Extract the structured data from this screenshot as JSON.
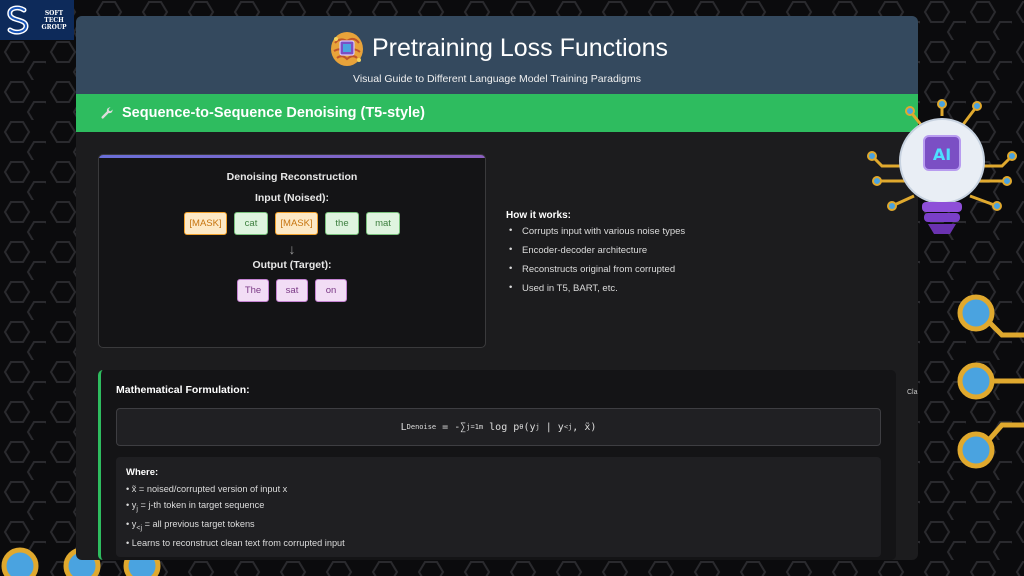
{
  "logo": {
    "text": "SOFT TECH GROUP"
  },
  "header": {
    "title": "Pretraining Loss Functions",
    "subtitle": "Visual Guide to Different Language Model Training Paradigms"
  },
  "section": {
    "title": "Sequence-to-Sequence Denoising (T5-style)"
  },
  "demo": {
    "title": "Denoising Reconstruction",
    "input_label": "Input (Noised):",
    "input_tokens": [
      {
        "text": "[MASK]",
        "kind": "mask"
      },
      {
        "text": "cat",
        "kind": "kept"
      },
      {
        "text": "[MASK]",
        "kind": "mask"
      },
      {
        "text": "the",
        "kind": "kept"
      },
      {
        "text": "mat",
        "kind": "kept"
      }
    ],
    "arrow": "↓",
    "output_label": "Output (Target):",
    "output_tokens": [
      "The",
      "sat",
      "on"
    ]
  },
  "how_it_works": {
    "title": "How it works:",
    "items": [
      "Corrupts input with various noise types",
      "Encoder-decoder architecture",
      "Reconstructs original from corrupted",
      "Used in T5, BART, etc."
    ]
  },
  "math": {
    "title": "Mathematical Formulation:",
    "formula_L": "L",
    "formula_sub": "Denoise",
    "formula_eq": " = -∑",
    "formula_sum_sub": "j=1",
    "formula_sum_sup": "m",
    "formula_rest": " log p",
    "formula_theta": "θ",
    "formula_y": "(y",
    "formula_yj": "j",
    "formula_mid": " | y",
    "formula_ylt": "<j",
    "formula_end": ", x̃)",
    "where_title": "Where:",
    "where_items": [
      {
        "pre": "• x̃ = noised/corrupted version of input x"
      },
      {
        "pre": "• y",
        "sub": "j",
        "post": " = j-th token in target sequence"
      },
      {
        "pre": "• y",
        "sub": "<j",
        "post": " = all previous target tokens"
      },
      {
        "pre": "• Learns to reconstruct clean text from corrupted input"
      }
    ]
  },
  "overlay": {
    "ai_label": "AI",
    "clip_text": "Cla"
  },
  "colors": {
    "header_bg": "#34495e",
    "section_bar": "#2ebc5f",
    "mask_token": "#f0a12c",
    "kept_token": "#7ac27d",
    "target_token": "#c583d2"
  }
}
